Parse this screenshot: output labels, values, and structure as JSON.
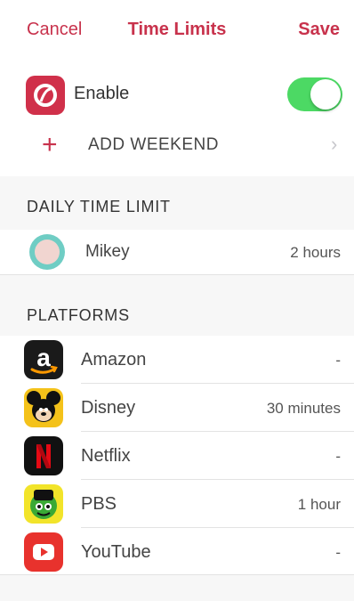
{
  "nav": {
    "cancel_label": "Cancel",
    "title": "Time Limits",
    "save_label": "Save"
  },
  "enable": {
    "label": "Enable",
    "on": true,
    "icon": "app-logo-icon"
  },
  "weekend": {
    "label": "ADD WEEKEND",
    "icon": "plus-icon"
  },
  "daily": {
    "header": "DAILY TIME LIMIT",
    "user": {
      "name": "Mikey",
      "limit": "2 hours"
    }
  },
  "platforms": {
    "header": "PLATFORMS",
    "items": [
      {
        "name": "Amazon",
        "value": "-",
        "icon": "amazon-icon"
      },
      {
        "name": "Disney",
        "value": "30 minutes",
        "icon": "disney-icon"
      },
      {
        "name": "Netflix",
        "value": "-",
        "icon": "netflix-icon"
      },
      {
        "name": "PBS",
        "value": "1 hour",
        "icon": "pbs-kids-icon"
      },
      {
        "name": "YouTube",
        "value": "-",
        "icon": "youtube-icon"
      }
    ]
  },
  "colors": {
    "accent": "#c8324c",
    "toggle_on": "#4cd964",
    "section_bg": "#f7f7f7"
  }
}
